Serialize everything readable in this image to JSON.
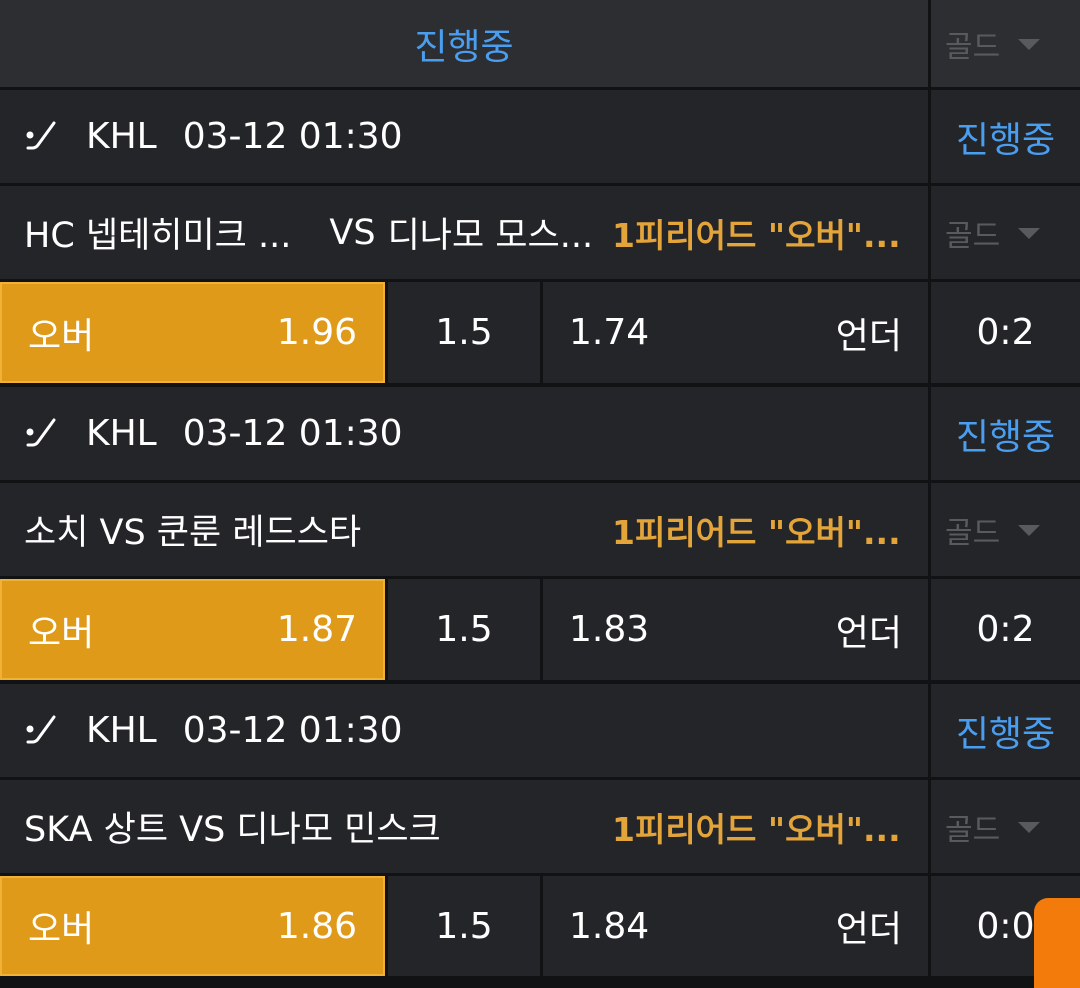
{
  "header": {
    "title": "진행중",
    "grade_select": "골드"
  },
  "matches": [
    {
      "league": "KHL",
      "datetime": "03-12 01:30",
      "status": "진행중",
      "home": "HC 넵테히미크 ...",
      "vs": "VS",
      "away": "디나모 모스...",
      "market": "1피리어드 \"오버\"...",
      "grade_select": "골드",
      "over_label": "오버",
      "over_odds": "1.96",
      "line": "1.5",
      "under_odds": "1.74",
      "under_label": "언더",
      "score": "0:2"
    },
    {
      "league": "KHL",
      "datetime": "03-12 01:30",
      "status": "진행중",
      "teams": "소치 VS 쿤룬 레드스타",
      "market": "1피리어드 \"오버\"...",
      "grade_select": "골드",
      "over_label": "오버",
      "over_odds": "1.87",
      "line": "1.5",
      "under_odds": "1.83",
      "under_label": "언더",
      "score": "0:2"
    },
    {
      "league": "KHL",
      "datetime": "03-12 01:30",
      "status": "진행중",
      "teams": "SKA 상트 VS 디나모 민스크",
      "market": "1피리어드 \"오버\"...",
      "grade_select": "골드",
      "over_label": "오버",
      "over_odds": "1.86",
      "line": "1.5",
      "under_odds": "1.84",
      "under_label": "언더",
      "score": "0:0"
    }
  ],
  "icons": {
    "sport": "hockey-stick-icon",
    "dropdown": "chevron-down-icon",
    "fab": "floating-action-button"
  },
  "colors": {
    "accent_blue": "#4a9ef0",
    "over_orange": "#e09a1a",
    "market_gold": "#e3a43a",
    "cell_bg": "#242529"
  }
}
